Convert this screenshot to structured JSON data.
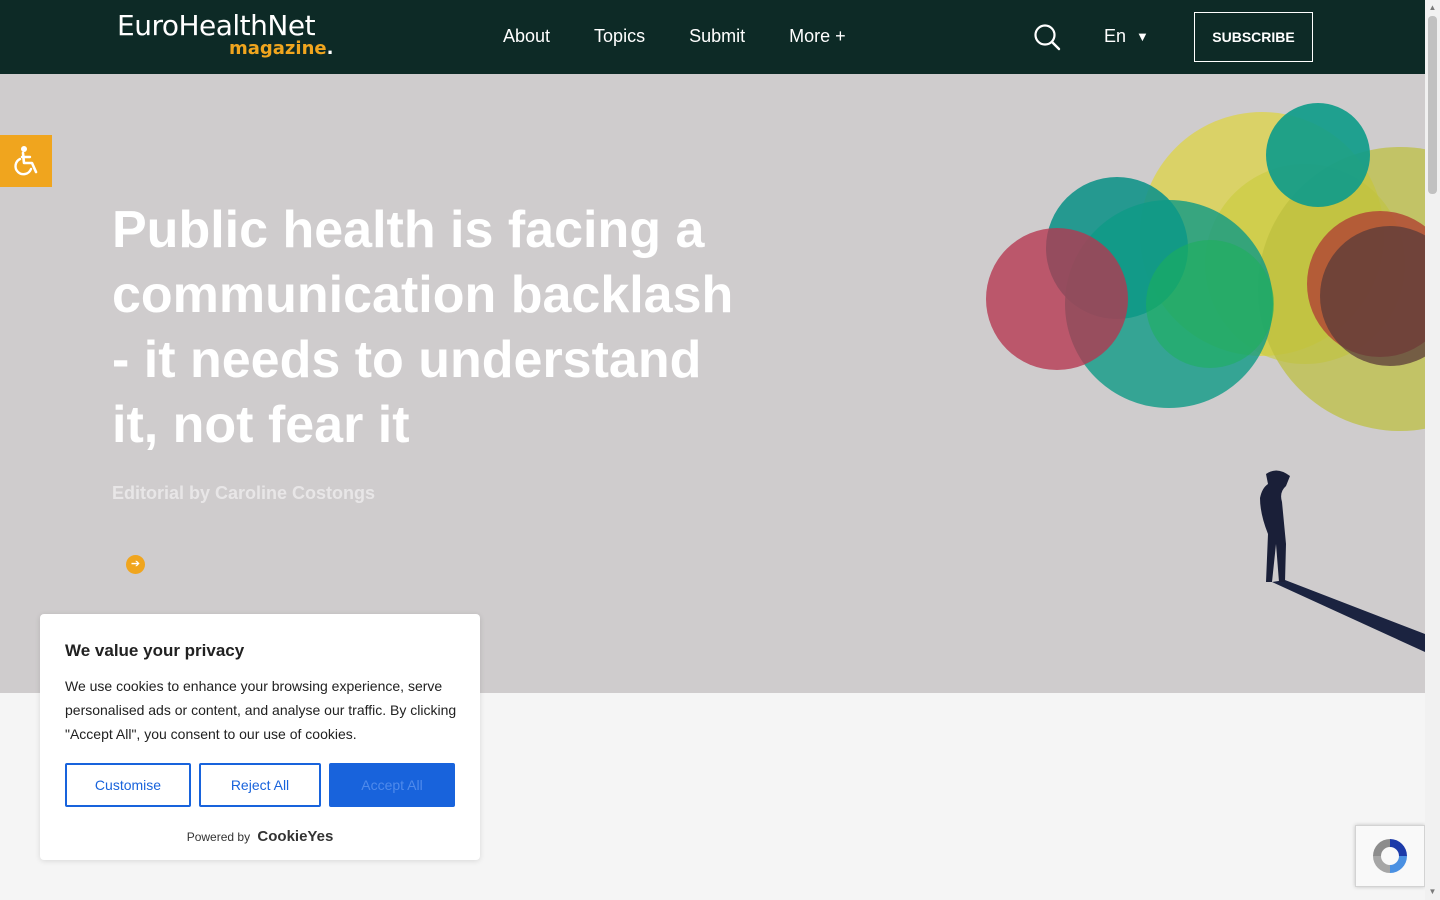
{
  "header": {
    "logo_main": "EuroHealthNet",
    "logo_sub": "magazine",
    "logo_dot": ".",
    "nav": [
      {
        "label": "About"
      },
      {
        "label": "Topics"
      },
      {
        "label": "Submit"
      },
      {
        "label": "More +"
      }
    ],
    "search_icon": "search-icon",
    "language": "En",
    "language_caret": "▼",
    "subscribe_label": "SUBSCRIBE"
  },
  "hero": {
    "title": "Public health is facing a communication backlash - it needs to understand it, not fear it",
    "subtitle": "Editorial by Caroline Costongs",
    "arrow_icon": "arrow-right-icon",
    "arrow_glyph": "➔"
  },
  "accessibility": {
    "icon": "wheelchair-icon"
  },
  "cookie": {
    "title": "We value your privacy",
    "text": "We use cookies to enhance your browsing experience, serve personalised ads or content, and analyse our traffic. By clicking \"Accept All\", you consent to our use of cookies.",
    "customise": "Customise",
    "reject": "Reject All",
    "accept": "Accept All",
    "powered_by": "Powered by",
    "brand": "CookieYes"
  },
  "recaptcha": {
    "icon": "recaptcha-icon"
  },
  "scrollbar": {
    "up_glyph": "▲",
    "down_glyph": "▼"
  },
  "colors": {
    "header_bg": "#0d2a26",
    "accent_orange": "#f0a51e",
    "hero_bg": "#cfcccd",
    "cookie_blue": "#1863dc"
  }
}
